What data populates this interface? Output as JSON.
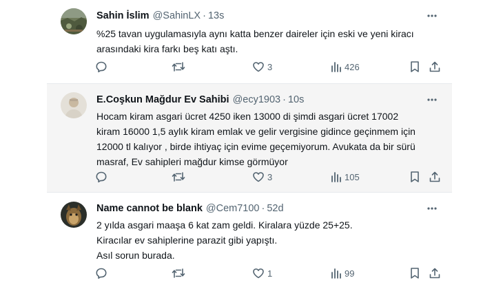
{
  "tweets": [
    {
      "name": "Sahin İslim",
      "handle": "@SahinLX",
      "separator": "·",
      "time": "13s",
      "lines": [
        "%25 tavan uygulamasıyla aynı katta benzer daireler için eski ve yeni kiracı",
        "arasındaki  kira farkı beş katı aştı."
      ],
      "likes": "3",
      "views": "426",
      "highlighted": false
    },
    {
      "name": "E.Coşkun Mağdur Ev Sahibi",
      "handle": "@ecy1903",
      "separator": "·",
      "time": "10s",
      "lines": [
        "Hocam kiram asgari ücret 4250 iken 13000 di şimdi asgari ücret 17002",
        "kiram 16000 1,5 aylık kiram emlak ve gelir vergisine gidince geçinmem için",
        "12000 tl kalıyor , birde ihtiyaç için evime geçemiyorum. Avukata da bir sürü",
        "masraf, Ev sahipleri mağdur kimse görmüyor"
      ],
      "likes": "3",
      "views": "105",
      "highlighted": true
    },
    {
      "name": "Name cannot be blank",
      "handle": "@Cem7100",
      "separator": "·",
      "time": "52d",
      "lines": [
        "2 yılda asgari maaşa 6 kat zam geldi. Kiralara yüzde 25+25.",
        "Kiracılar ev sahiplerine parazit gibi yapıştı.",
        "Asıl sorun burada."
      ],
      "likes": "1",
      "views": "99",
      "highlighted": false
    }
  ],
  "icons": {
    "reply": "reply-icon",
    "retweet": "retweet-icon",
    "like": "heart-icon",
    "views": "views-icon",
    "bookmark": "bookmark-icon",
    "share": "share-icon",
    "more": "more-icon"
  },
  "colors": {
    "text": "#0f1419",
    "muted": "#536471",
    "divider": "#e6e9ec",
    "highlight_bg": "#f5f5f5"
  }
}
